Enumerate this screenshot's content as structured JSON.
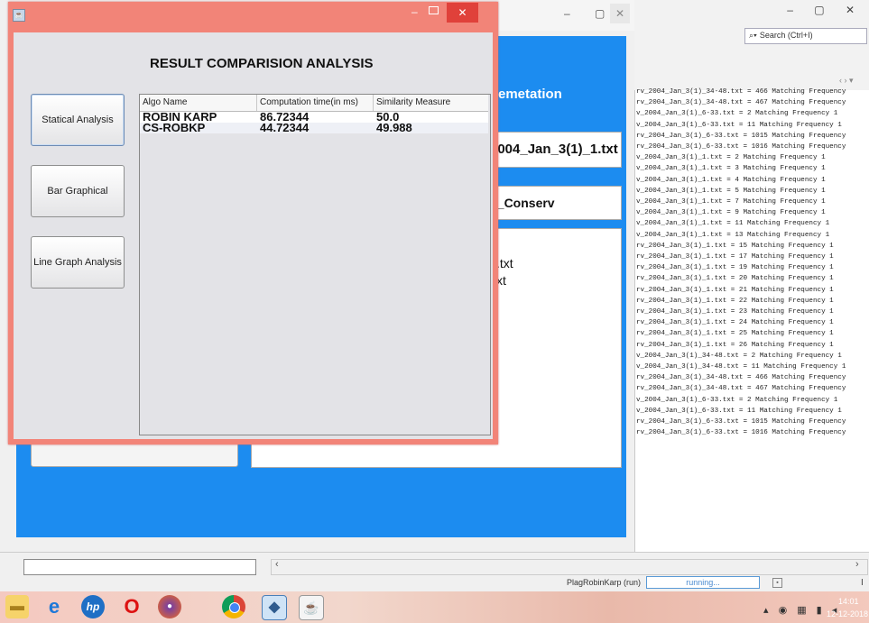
{
  "ide": {
    "search_placeholder": "Search (Ctrl+I)",
    "output_lines": [
      "rv_2004_Jan_3(1)_34-48.txt = 466 Matching Frequency",
      "rv_2004_Jan_3(1)_34-48.txt = 467 Matching Frequency",
      "v_2004_Jan_3(1)_6-33.txt = 2 Matching Frequency 1",
      "v_2004_Jan_3(1)_6-33.txt = 11 Matching Frequency 1",
      "rv_2004_Jan_3(1)_6-33.txt = 1015 Matching Frequency",
      "rv_2004_Jan_3(1)_6-33.txt = 1016 Matching Frequency",
      "v_2004_Jan_3(1)_1.txt = 2 Matching Frequency 1",
      "v_2004_Jan_3(1)_1.txt = 3 Matching Frequency 1",
      "v_2004_Jan_3(1)_1.txt = 4 Matching Frequency 1",
      "v_2004_Jan_3(1)_1.txt = 5 Matching Frequency 1",
      "v_2004_Jan_3(1)_1.txt = 7 Matching Frequency 1",
      "v_2004_Jan_3(1)_1.txt = 9 Matching Frequency 1",
      "v_2004_Jan_3(1)_1.txt = 11 Matching Frequency 1",
      "v_2004_Jan_3(1)_1.txt = 13 Matching Frequency 1",
      "rv_2004_Jan_3(1)_1.txt = 15 Matching Frequency 1",
      "rv_2004_Jan_3(1)_1.txt = 17 Matching Frequency 1",
      "rv_2004_Jan_3(1)_1.txt = 19 Matching Frequency 1",
      "rv_2004_Jan_3(1)_1.txt = 20 Matching Frequency 1",
      "rv_2004_Jan_3(1)_1.txt = 21 Matching Frequency 1",
      "rv_2004_Jan_3(1)_1.txt = 22 Matching Frequency 1",
      "rv_2004_Jan_3(1)_1.txt = 23 Matching Frequency 1",
      "rv_2004_Jan_3(1)_1.txt = 24 Matching Frequency 1",
      "rv_2004_Jan_3(1)_1.txt = 25 Matching Frequency 1",
      "rv_2004_Jan_3(1)_1.txt = 26 Matching Frequency 1",
      "v_2004_Jan_3(1)_34-48.txt = 2 Matching Frequency 1",
      "v_2004_Jan_3(1)_34-48.txt = 11 Matching Frequency 1",
      "rv_2004_Jan_3(1)_34-48.txt = 466 Matching Frequency",
      "rv_2004_Jan_3(1)_34-48.txt = 467 Matching Frequency",
      "v_2004_Jan_3(1)_6-33.txt = 2 Matching Frequency 1",
      "v_2004_Jan_3(1)_6-33.txt = 11 Matching Frequency 1",
      "rv_2004_Jan_3(1)_6-33.txt = 1015 Matching Frequency",
      "rv_2004_Jan_3(1)_6-33.txt = 1016 Matching Frequency"
    ],
    "run_label": "PlagRobinKarp (run)",
    "run_status": "running..."
  },
  "blue_app": {
    "heading": "emetation",
    "field1": "2004_Jan_3(1)_1.txt",
    "field2": "e_Conserv",
    "text_lines": [
      ".txt",
      "xt"
    ]
  },
  "dialog": {
    "title": "RESULT COMPARISION ANALYSIS",
    "buttons": {
      "statical": "Statical Analysis",
      "bar": "Bar Graphical Analysis",
      "line": "Line Graph Analysis"
    },
    "table": {
      "headers": [
        "Algo Name",
        "Computation time(in ms)",
        "Similarity Measure"
      ],
      "rows": [
        [
          "ROBIN KARP",
          "86.72344",
          "50.0"
        ],
        [
          "CS-ROBKP",
          "44.72344",
          "49.988"
        ]
      ]
    }
  },
  "taskbar": {
    "time": "14:01",
    "date": "12-12-2018"
  }
}
